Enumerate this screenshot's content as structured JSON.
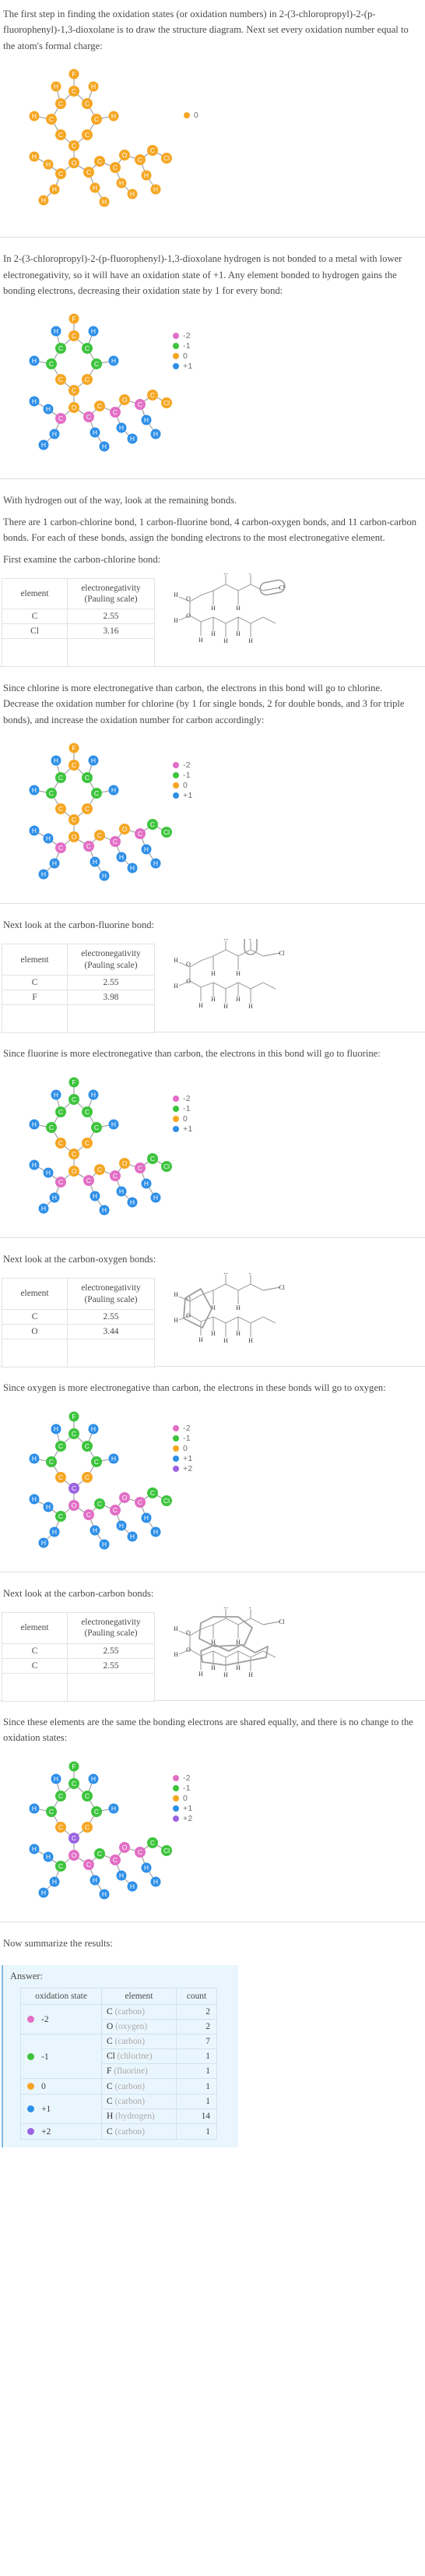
{
  "compound": "2-(3-chloropropyl)-2-(p-fluorophenyl)-1,3-dioxolane",
  "steps": {
    "s1": "The first step in finding the oxidation states (or oxidation numbers) in 2-(3-chloropropyl)-2-(p-fluorophenyl)-1,3-dioxolane is to draw the structure diagram. Next set every oxidation number equal to the atom's formal charge:",
    "s2": "In 2-(3-chloropropyl)-2-(p-fluorophenyl)-1,3-dioxolane hydrogen is not bonded to a metal with lower electronegativity, so it will have an oxidation state of +1. Any element bonded to hydrogen gains the bonding electrons, decreasing their oxidation state by 1 for every bond:",
    "s3a": "With hydrogen out of the way, look at the remaining bonds.",
    "s3b": "There are 1 carbon-chlorine bond, 1 carbon-fluorine bond, 4 carbon-oxygen bonds, and 11 carbon-carbon bonds.  For each of these bonds, assign the bonding electrons to the most electronegative element.",
    "s3c": "First examine the carbon-chlorine bond:",
    "s4": "Since chlorine is more electronegative than carbon, the electrons in this bond will go to chlorine. Decrease the oxidation number for chlorine (by 1 for single bonds, 2 for double bonds, and 3 for triple bonds), and increase the oxidation number for carbon accordingly:",
    "s5": "Next look at the carbon-fluorine bond:",
    "s6": "Since fluorine is more electronegative than carbon, the electrons in this bond will go to fluorine:",
    "s7": "Next look at the carbon-oxygen bonds:",
    "s8": "Since oxygen is more electronegative than carbon, the electrons in these bonds will go to oxygen:",
    "s9": "Next look at the carbon-carbon bonds:",
    "s10": "Since these elements are the same the bonding electrons are shared equally, and there is no change to the oxidation states:",
    "s11": "Now summarize the results:"
  },
  "en_tables": [
    {
      "id": "cl",
      "headers": [
        "element",
        "electronegativity (Pauling scale)"
      ],
      "rows": [
        {
          "element": "C",
          "en": "2.55"
        },
        {
          "element": "Cl",
          "en": "3.16"
        }
      ]
    },
    {
      "id": "f",
      "headers": [
        "element",
        "electronegativity (Pauling scale)"
      ],
      "rows": [
        {
          "element": "C",
          "en": "2.55"
        },
        {
          "element": "F",
          "en": "3.98"
        }
      ]
    },
    {
      "id": "o",
      "headers": [
        "element",
        "electronegativity (Pauling scale)"
      ],
      "rows": [
        {
          "element": "C",
          "en": "2.55"
        },
        {
          "element": "O",
          "en": "3.44"
        }
      ]
    },
    {
      "id": "cc",
      "headers": [
        "element",
        "electronegativity (Pauling scale)"
      ],
      "rows": [
        {
          "element": "C",
          "en": "2.55"
        },
        {
          "element": "C",
          "en": "2.55"
        }
      ]
    }
  ],
  "header_en_label_line1": "electronegativity",
  "header_en_label_line2": "(Pauling scale)",
  "header_element_label": "element",
  "legends": {
    "all_zero": [
      {
        "value": "0",
        "color": "#f5a623"
      }
    ],
    "after_h": [
      {
        "value": "-2",
        "color": "#e26ec5"
      },
      {
        "value": "-1",
        "color": "#3dc43d"
      },
      {
        "value": "0",
        "color": "#f5a623"
      },
      {
        "value": "+1",
        "color": "#2e8fe8"
      }
    ],
    "after_cl": [
      {
        "value": "-2",
        "color": "#e26ec5"
      },
      {
        "value": "-1",
        "color": "#3dc43d"
      },
      {
        "value": "0",
        "color": "#f5a623"
      },
      {
        "value": "+1",
        "color": "#2e8fe8"
      }
    ],
    "after_f": [
      {
        "value": "-2",
        "color": "#e26ec5"
      },
      {
        "value": "-1",
        "color": "#3dc43d"
      },
      {
        "value": "0",
        "color": "#f5a623"
      },
      {
        "value": "+1",
        "color": "#2e8fe8"
      }
    ],
    "after_o": [
      {
        "value": "-2",
        "color": "#e26ec5"
      },
      {
        "value": "-1",
        "color": "#3dc43d"
      },
      {
        "value": "0",
        "color": "#f5a623"
      },
      {
        "value": "+1",
        "color": "#2e8fe8"
      },
      {
        "value": "+2",
        "color": "#9b63e0"
      }
    ],
    "final": [
      {
        "value": "-2",
        "color": "#e26ec5"
      },
      {
        "value": "-1",
        "color": "#3dc43d"
      },
      {
        "value": "0",
        "color": "#f5a623"
      },
      {
        "value": "+1",
        "color": "#2e8fe8"
      },
      {
        "value": "+2",
        "color": "#9b63e0"
      }
    ]
  },
  "answer": {
    "label": "Answer:",
    "headers": [
      "oxidation state",
      "element",
      "count"
    ],
    "groups": [
      {
        "state": "-2",
        "color": "#e26ec5",
        "rows": [
          {
            "symbol": "C",
            "name": "(carbon)",
            "count": "2"
          },
          {
            "symbol": "O",
            "name": "(oxygen)",
            "count": "2"
          }
        ]
      },
      {
        "state": "-1",
        "color": "#3dc43d",
        "rows": [
          {
            "symbol": "C",
            "name": "(carbon)",
            "count": "7"
          },
          {
            "symbol": "Cl",
            "name": "(chlorine)",
            "count": "1"
          },
          {
            "symbol": "F",
            "name": "(fluorine)",
            "count": "1"
          }
        ]
      },
      {
        "state": "0",
        "color": "#f5a623",
        "rows": [
          {
            "symbol": "C",
            "name": "(carbon)",
            "count": "1"
          }
        ]
      },
      {
        "state": "+1",
        "color": "#2e8fe8",
        "rows": [
          {
            "symbol": "C",
            "name": "(carbon)",
            "count": "1"
          },
          {
            "symbol": "H",
            "name": "(hydrogen)",
            "count": "14"
          }
        ]
      },
      {
        "state": "+2",
        "color": "#9b63e0",
        "rows": [
          {
            "symbol": "C",
            "name": "(carbon)",
            "count": "1"
          }
        ]
      }
    ]
  },
  "atom_labels": {
    "C": "C",
    "H": "H",
    "O": "O",
    "Cl": "Cl",
    "F": "F"
  },
  "chart_data": {
    "type": "table",
    "title": "Oxidation states in 2-(3-chloropropyl)-2-(p-fluorophenyl)-1,3-dioxolane",
    "categories": [
      "-2",
      "-1",
      "0",
      "+1",
      "+2"
    ],
    "series": [
      {
        "name": "C (carbon)",
        "values": [
          2,
          7,
          1,
          1,
          1
        ]
      },
      {
        "name": "O (oxygen)",
        "values": [
          2,
          0,
          0,
          0,
          0
        ]
      },
      {
        "name": "Cl (chlorine)",
        "values": [
          0,
          1,
          0,
          0,
          0
        ]
      },
      {
        "name": "F (fluorine)",
        "values": [
          0,
          1,
          0,
          0,
          0
        ]
      },
      {
        "name": "H (hydrogen)",
        "values": [
          0,
          0,
          0,
          14,
          0
        ]
      }
    ],
    "xlabel": "oxidation state",
    "ylabel": "count",
    "legend": [
      "C (carbon)",
      "O (oxygen)",
      "Cl (chlorine)",
      "F (fluorine)",
      "H (hydrogen)"
    ]
  }
}
